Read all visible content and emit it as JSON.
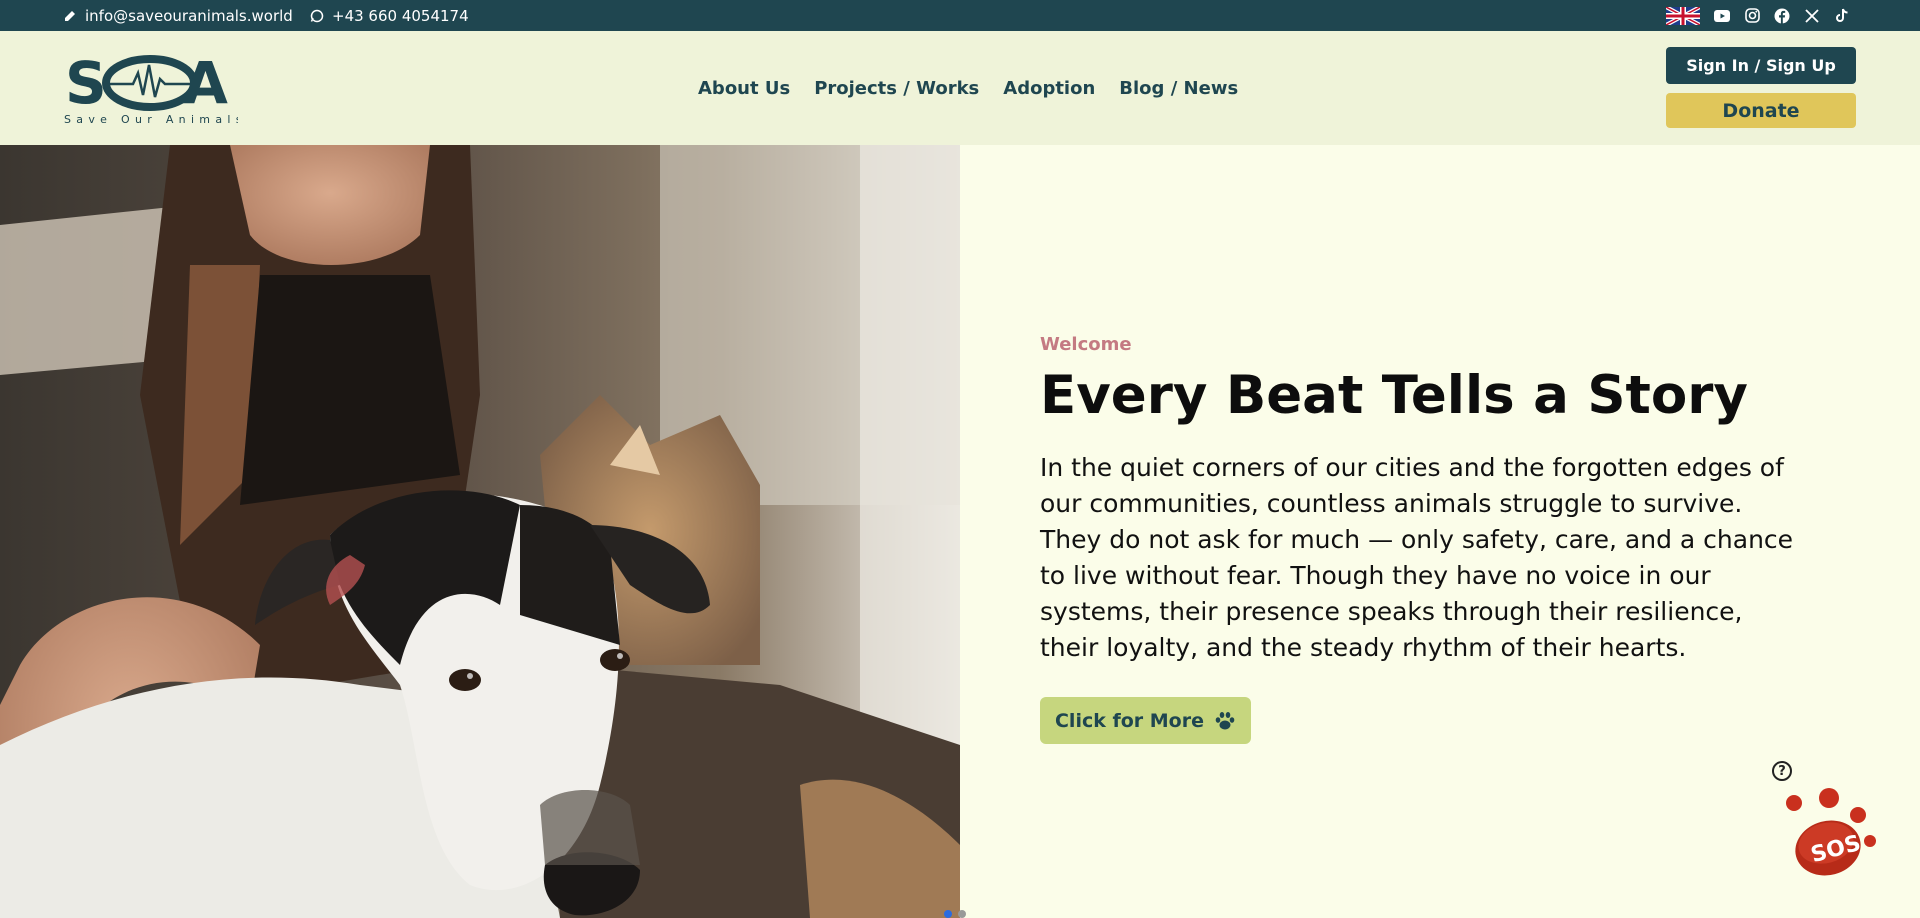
{
  "topbar": {
    "email": "info@saveouranimals.world",
    "phone": "+43 660 4054174",
    "social": [
      "uk-flag-icon",
      "youtube-icon",
      "instagram-icon",
      "facebook-icon",
      "x-icon",
      "tiktok-icon"
    ]
  },
  "header": {
    "logo_text": "SOA",
    "logo_subtitle": "Save Our Animals",
    "nav": [
      "About Us",
      "Projects / Works",
      "Adoption",
      "Blog / News"
    ],
    "sign_in": "Sign In / Sign Up",
    "donate": "Donate"
  },
  "hero": {
    "eyebrow": "Welcome",
    "title": "Every Beat Tells a Story",
    "paragraph": "In the quiet corners of our cities and the forgotten edges of our communities, countless animals struggle to survive. They do not ask for much — only safety, care, and a chance to live without fear. Though they have no voice in our systems, their presence speaks through their resilience, their loyalty, and the steady rhythm of their hearts.",
    "cta": "Click for More"
  },
  "sos": {
    "label": "SOS",
    "help": "?"
  },
  "colors": {
    "primary": "#1f4650",
    "accent": "#e0c65a",
    "cta": "#c6d67e",
    "eyebrow": "#c47a82",
    "sos": "#c9301e"
  }
}
